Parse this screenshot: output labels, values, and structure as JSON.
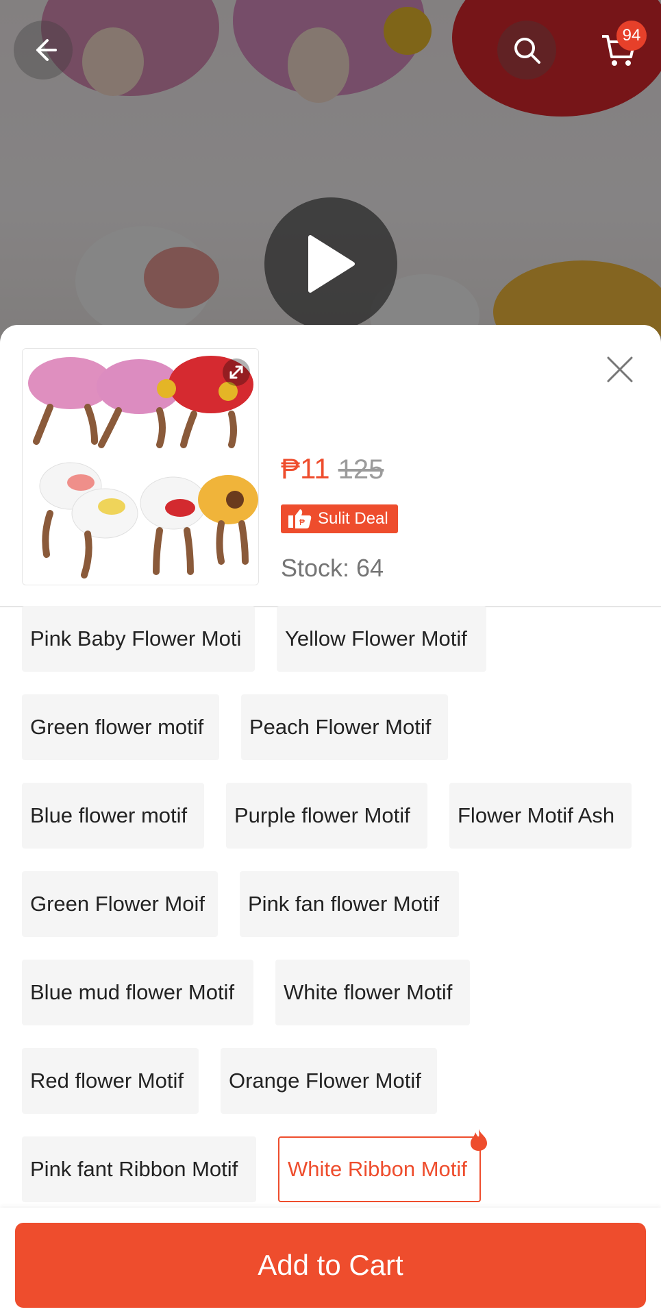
{
  "header": {
    "back_icon": "arrow-left-icon",
    "search_icon": "search-icon",
    "cart_icon": "cart-icon",
    "cart_count": "94",
    "play_icon": "play-icon"
  },
  "product": {
    "price": "₱11",
    "original_price": "125",
    "deal_label": "Sulit Deal",
    "stock": "Stock: 64"
  },
  "options": [
    [
      "Pink Baby Flower Moti",
      "Yellow Flower Motif"
    ],
    [
      "Green flower motif",
      "Peach Flower Motif"
    ],
    [
      "Blue flower motif",
      "Purple flower Motif",
      "Flower Motif Ash"
    ],
    [
      "Green Flower Moif",
      "Pink fan flower Motif"
    ],
    [
      "Blue mud flower Motif",
      "White flower Motif"
    ],
    [
      "Red flower Motif",
      "Orange Flower Motif"
    ],
    [
      "Pink fant Ribbon Motif",
      "White Ribbon Motif"
    ]
  ],
  "selected_option": "White Ribbon Motif",
  "footer": {
    "add_to_cart": "Add to Cart"
  },
  "colors": {
    "accent": "#ee4d2d",
    "chip_bg": "#f5f5f5"
  }
}
